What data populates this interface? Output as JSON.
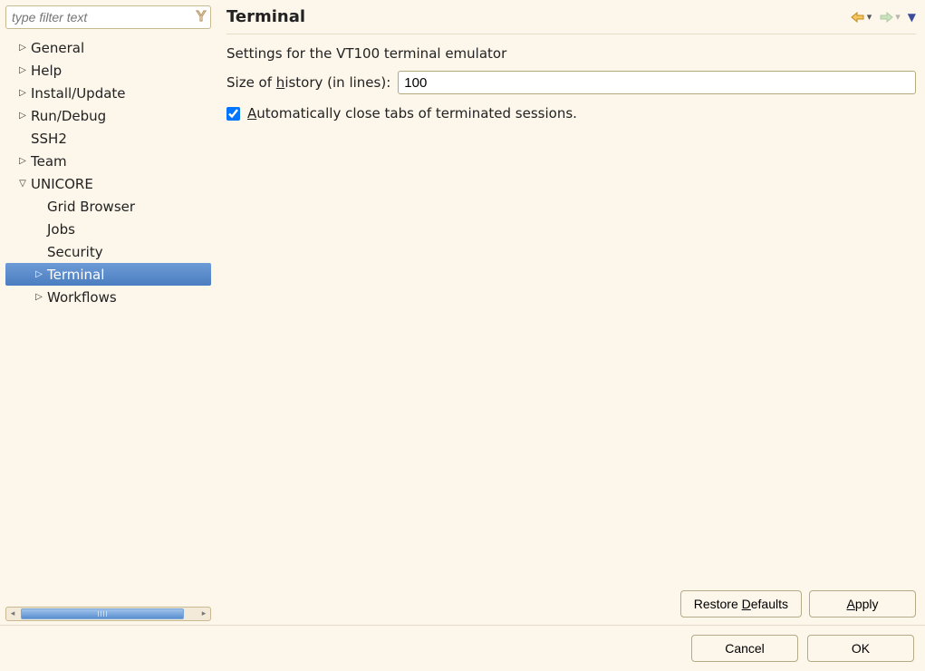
{
  "filter": {
    "placeholder": "type filter text"
  },
  "tree": {
    "general": "General",
    "help": "Help",
    "install_update": "Install/Update",
    "run_debug": "Run/Debug",
    "ssh2": "SSH2",
    "team": "Team",
    "unicore": "UNICORE",
    "unicore_children": {
      "grid_browser": "Grid Browser",
      "jobs": "Jobs",
      "security": "Security",
      "terminal": "Terminal",
      "workflows": "Workflows"
    }
  },
  "page": {
    "title": "Terminal",
    "description": "Settings for the VT100 terminal emulator",
    "history_label_pre": "Size of ",
    "history_label_underline": "h",
    "history_label_post": "istory (in lines):",
    "history_value": "100",
    "autoclose_pre": "",
    "autoclose_underline": "A",
    "autoclose_post": "utomatically close tabs of terminated sessions.",
    "autoclose_checked": true
  },
  "buttons": {
    "restore_defaults_pre": "Restore ",
    "restore_defaults_underline": "D",
    "restore_defaults_post": "efaults",
    "apply_underline": "A",
    "apply_post": "pply",
    "cancel": "Cancel",
    "ok": "OK"
  }
}
